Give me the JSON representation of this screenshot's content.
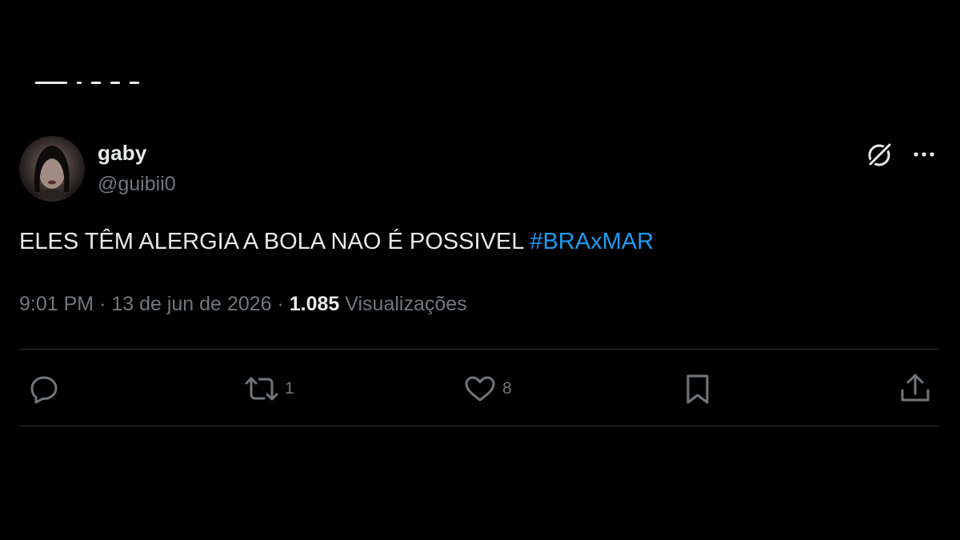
{
  "tweet": {
    "author": {
      "display_name": "gaby",
      "handle": "@guibii0"
    },
    "text": "ELES TÊM ALERGIA A BOLA NAO É POSSIVEL",
    "hashtag": "#BRAxMAR",
    "time": "9:01 PM",
    "separator": "·",
    "date": "13 de jun de 2026",
    "views_count": "1.085",
    "views_label": "Visualizações"
  },
  "actions": {
    "reply": {
      "icon": "reply-icon",
      "count": ""
    },
    "retweet": {
      "icon": "retweet-icon",
      "count": "1"
    },
    "like": {
      "icon": "heart-icon",
      "count": "8"
    },
    "bookmark": {
      "icon": "bookmark-icon",
      "count": ""
    },
    "share": {
      "icon": "share-icon",
      "count": ""
    }
  },
  "header_icons": [
    "grok-icon",
    "more-icon"
  ],
  "colors": {
    "background": "#000000",
    "text": "#e7e9ea",
    "secondary": "#71767b",
    "accent": "#1d9bf0",
    "divider": "#2f3336"
  }
}
